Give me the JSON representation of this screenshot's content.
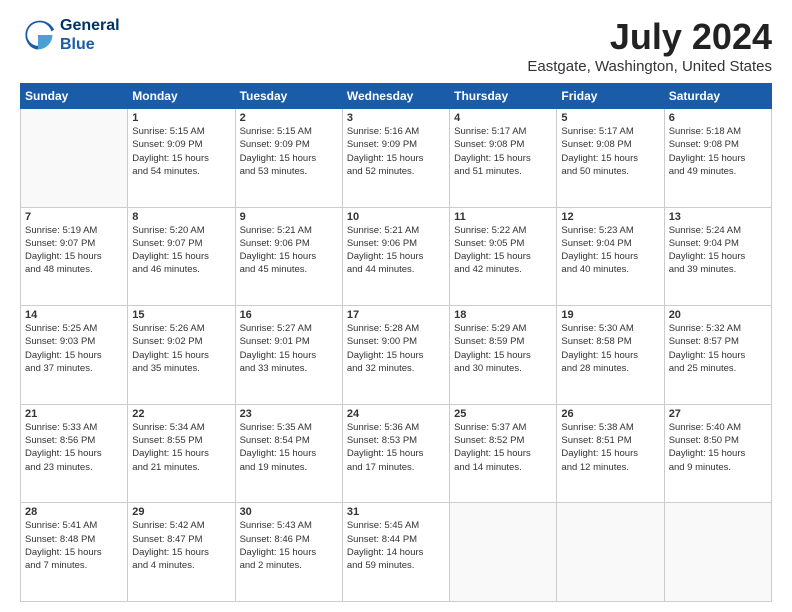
{
  "header": {
    "logo_line1": "General",
    "logo_line2": "Blue",
    "title": "July 2024",
    "subtitle": "Eastgate, Washington, United States"
  },
  "weekdays": [
    "Sunday",
    "Monday",
    "Tuesday",
    "Wednesday",
    "Thursday",
    "Friday",
    "Saturday"
  ],
  "weeks": [
    [
      {
        "day": "",
        "info": ""
      },
      {
        "day": "1",
        "info": "Sunrise: 5:15 AM\nSunset: 9:09 PM\nDaylight: 15 hours\nand 54 minutes."
      },
      {
        "day": "2",
        "info": "Sunrise: 5:15 AM\nSunset: 9:09 PM\nDaylight: 15 hours\nand 53 minutes."
      },
      {
        "day": "3",
        "info": "Sunrise: 5:16 AM\nSunset: 9:09 PM\nDaylight: 15 hours\nand 52 minutes."
      },
      {
        "day": "4",
        "info": "Sunrise: 5:17 AM\nSunset: 9:08 PM\nDaylight: 15 hours\nand 51 minutes."
      },
      {
        "day": "5",
        "info": "Sunrise: 5:17 AM\nSunset: 9:08 PM\nDaylight: 15 hours\nand 50 minutes."
      },
      {
        "day": "6",
        "info": "Sunrise: 5:18 AM\nSunset: 9:08 PM\nDaylight: 15 hours\nand 49 minutes."
      }
    ],
    [
      {
        "day": "7",
        "info": "Sunrise: 5:19 AM\nSunset: 9:07 PM\nDaylight: 15 hours\nand 48 minutes."
      },
      {
        "day": "8",
        "info": "Sunrise: 5:20 AM\nSunset: 9:07 PM\nDaylight: 15 hours\nand 46 minutes."
      },
      {
        "day": "9",
        "info": "Sunrise: 5:21 AM\nSunset: 9:06 PM\nDaylight: 15 hours\nand 45 minutes."
      },
      {
        "day": "10",
        "info": "Sunrise: 5:21 AM\nSunset: 9:06 PM\nDaylight: 15 hours\nand 44 minutes."
      },
      {
        "day": "11",
        "info": "Sunrise: 5:22 AM\nSunset: 9:05 PM\nDaylight: 15 hours\nand 42 minutes."
      },
      {
        "day": "12",
        "info": "Sunrise: 5:23 AM\nSunset: 9:04 PM\nDaylight: 15 hours\nand 40 minutes."
      },
      {
        "day": "13",
        "info": "Sunrise: 5:24 AM\nSunset: 9:04 PM\nDaylight: 15 hours\nand 39 minutes."
      }
    ],
    [
      {
        "day": "14",
        "info": "Sunrise: 5:25 AM\nSunset: 9:03 PM\nDaylight: 15 hours\nand 37 minutes."
      },
      {
        "day": "15",
        "info": "Sunrise: 5:26 AM\nSunset: 9:02 PM\nDaylight: 15 hours\nand 35 minutes."
      },
      {
        "day": "16",
        "info": "Sunrise: 5:27 AM\nSunset: 9:01 PM\nDaylight: 15 hours\nand 33 minutes."
      },
      {
        "day": "17",
        "info": "Sunrise: 5:28 AM\nSunset: 9:00 PM\nDaylight: 15 hours\nand 32 minutes."
      },
      {
        "day": "18",
        "info": "Sunrise: 5:29 AM\nSunset: 8:59 PM\nDaylight: 15 hours\nand 30 minutes."
      },
      {
        "day": "19",
        "info": "Sunrise: 5:30 AM\nSunset: 8:58 PM\nDaylight: 15 hours\nand 28 minutes."
      },
      {
        "day": "20",
        "info": "Sunrise: 5:32 AM\nSunset: 8:57 PM\nDaylight: 15 hours\nand 25 minutes."
      }
    ],
    [
      {
        "day": "21",
        "info": "Sunrise: 5:33 AM\nSunset: 8:56 PM\nDaylight: 15 hours\nand 23 minutes."
      },
      {
        "day": "22",
        "info": "Sunrise: 5:34 AM\nSunset: 8:55 PM\nDaylight: 15 hours\nand 21 minutes."
      },
      {
        "day": "23",
        "info": "Sunrise: 5:35 AM\nSunset: 8:54 PM\nDaylight: 15 hours\nand 19 minutes."
      },
      {
        "day": "24",
        "info": "Sunrise: 5:36 AM\nSunset: 8:53 PM\nDaylight: 15 hours\nand 17 minutes."
      },
      {
        "day": "25",
        "info": "Sunrise: 5:37 AM\nSunset: 8:52 PM\nDaylight: 15 hours\nand 14 minutes."
      },
      {
        "day": "26",
        "info": "Sunrise: 5:38 AM\nSunset: 8:51 PM\nDaylight: 15 hours\nand 12 minutes."
      },
      {
        "day": "27",
        "info": "Sunrise: 5:40 AM\nSunset: 8:50 PM\nDaylight: 15 hours\nand 9 minutes."
      }
    ],
    [
      {
        "day": "28",
        "info": "Sunrise: 5:41 AM\nSunset: 8:48 PM\nDaylight: 15 hours\nand 7 minutes."
      },
      {
        "day": "29",
        "info": "Sunrise: 5:42 AM\nSunset: 8:47 PM\nDaylight: 15 hours\nand 4 minutes."
      },
      {
        "day": "30",
        "info": "Sunrise: 5:43 AM\nSunset: 8:46 PM\nDaylight: 15 hours\nand 2 minutes."
      },
      {
        "day": "31",
        "info": "Sunrise: 5:45 AM\nSunset: 8:44 PM\nDaylight: 14 hours\nand 59 minutes."
      },
      {
        "day": "",
        "info": ""
      },
      {
        "day": "",
        "info": ""
      },
      {
        "day": "",
        "info": ""
      }
    ]
  ]
}
